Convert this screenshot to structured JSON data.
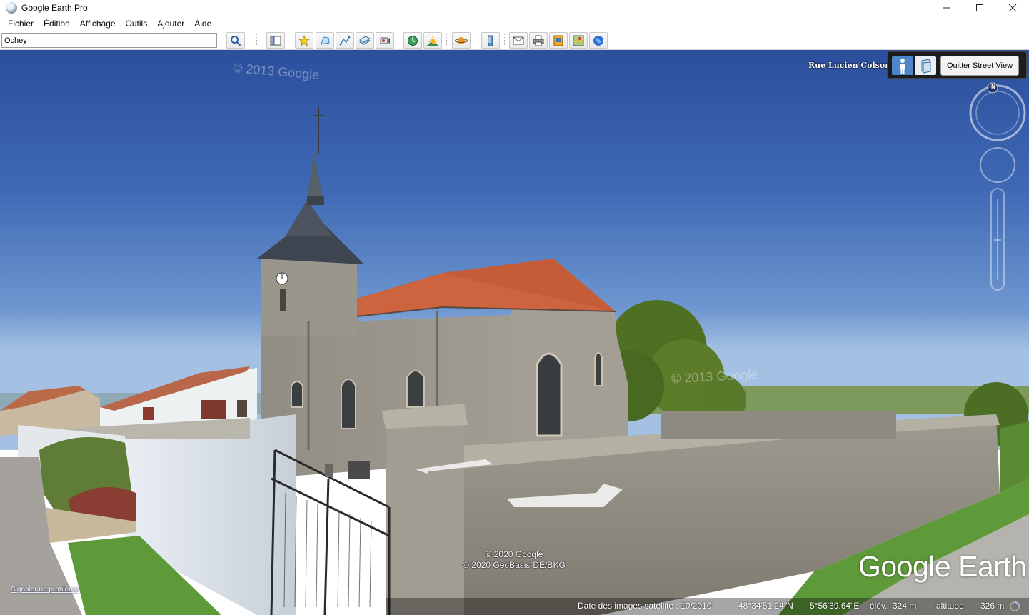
{
  "window": {
    "title": "Google Earth Pro",
    "controls": {
      "minimize": "—",
      "maximize": "☐",
      "close": "✕"
    }
  },
  "menu": [
    {
      "label": "Fichier"
    },
    {
      "label": "Édition"
    },
    {
      "label": "Affichage"
    },
    {
      "label": "Outils"
    },
    {
      "label": "Ajouter"
    },
    {
      "label": "Aide"
    }
  ],
  "toolbar": {
    "search_value": "Ochey",
    "buttons": [
      "search-icon",
      "sidebar-icon",
      "placemark-icon",
      "polygon-icon",
      "path-icon",
      "image-overlay-icon",
      "record-tour-icon",
      "historical-imagery-icon",
      "sunlight-icon",
      "planets-icon",
      "ruler-icon",
      "email-icon",
      "print-icon",
      "save-image-icon",
      "maps-icon",
      "earth-globe-icon"
    ]
  },
  "streetview": {
    "street_name": "Rue Lucien Colson",
    "quit_label": "Quitter Street View",
    "compass_north": "N",
    "copyright_lines": [
      "© 2020 Google",
      "© 2020 GeoBasis-DE/BKG"
    ],
    "watermark_top": "© 2013 Google",
    "watermark_mid": "© 2013 Google",
    "report_link": "Signaler un problème",
    "logo": "Google Earth"
  },
  "status": {
    "imagery_date": "Date des images satellite : 10/2010",
    "latitude": "48°34'51.24\"N",
    "longitude": "5°56'39.64\"E",
    "elevation_label": "élév.",
    "elevation": "324 m",
    "altitude_label": "altitude",
    "altitude": "326 m"
  },
  "colors": {
    "sky_top": "#2d54a6",
    "sky_bottom": "#8fb1dc",
    "roof": "#c9623e",
    "stone": "#8f8b82",
    "grass": "#5f9a3a"
  }
}
